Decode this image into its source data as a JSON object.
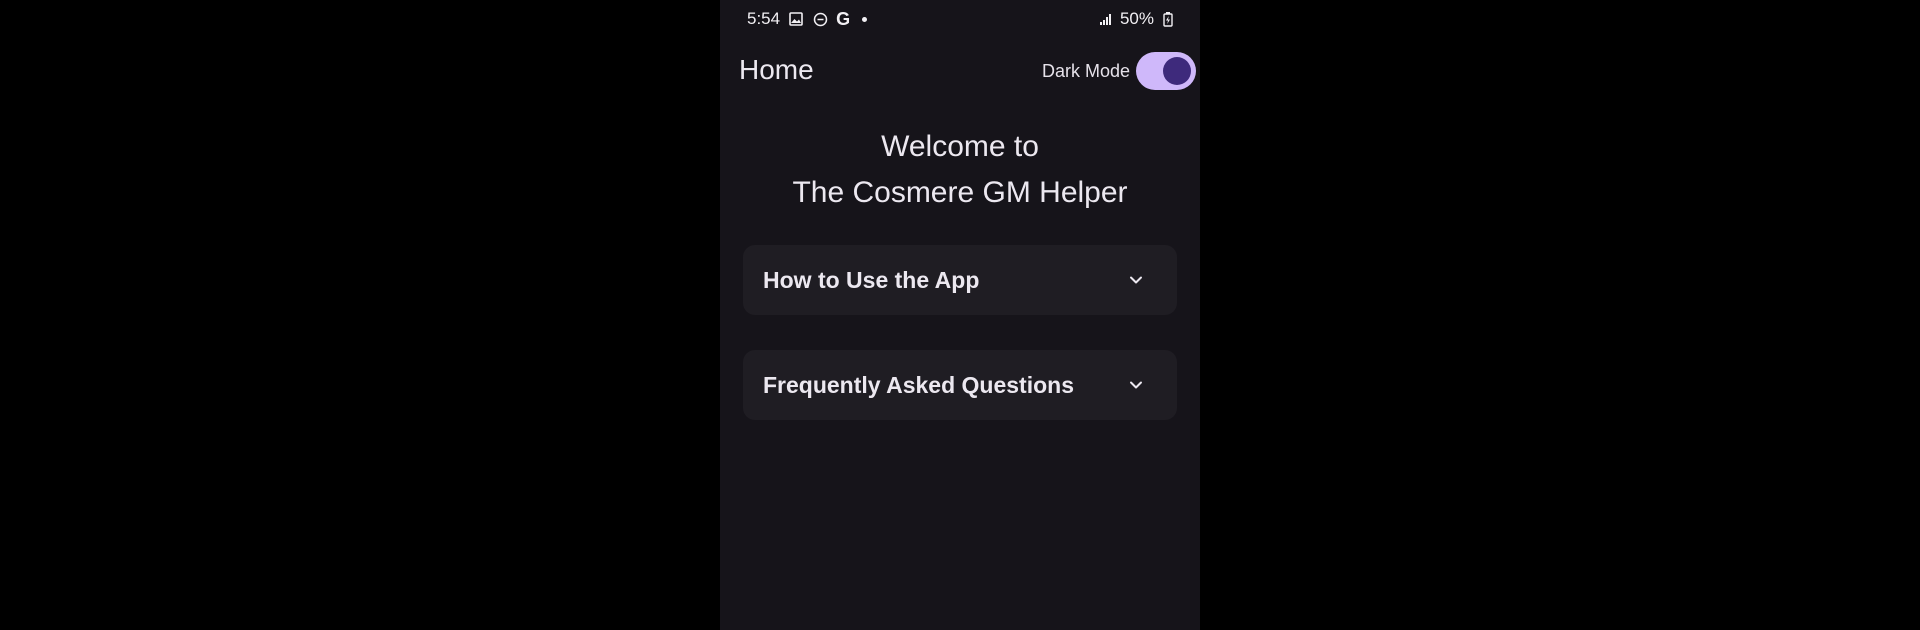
{
  "status_bar": {
    "time": "5:54",
    "icons": [
      "image-icon",
      "do-not-disturb-icon",
      "google-icon",
      "dot-icon"
    ],
    "g_letter": "G",
    "battery": "50%",
    "right_icons": [
      "signal-icon",
      "battery-charging-icon"
    ]
  },
  "app_bar": {
    "title": "Home",
    "dark_mode_label": "Dark Mode",
    "dark_mode_on": true
  },
  "welcome": {
    "line1": "Welcome to",
    "line2": "The Cosmere GM Helper"
  },
  "accordions": [
    {
      "title": "How to Use the App",
      "icon": "chevron-down-icon"
    },
    {
      "title": "Frequently Asked Questions",
      "icon": "chevron-down-icon"
    }
  ],
  "colors": {
    "background": "#16141a",
    "card": "#1f1d23",
    "toggle_track": "#cfb8fa",
    "toggle_knob": "#3e2a7c",
    "text": "#ece8f0"
  }
}
